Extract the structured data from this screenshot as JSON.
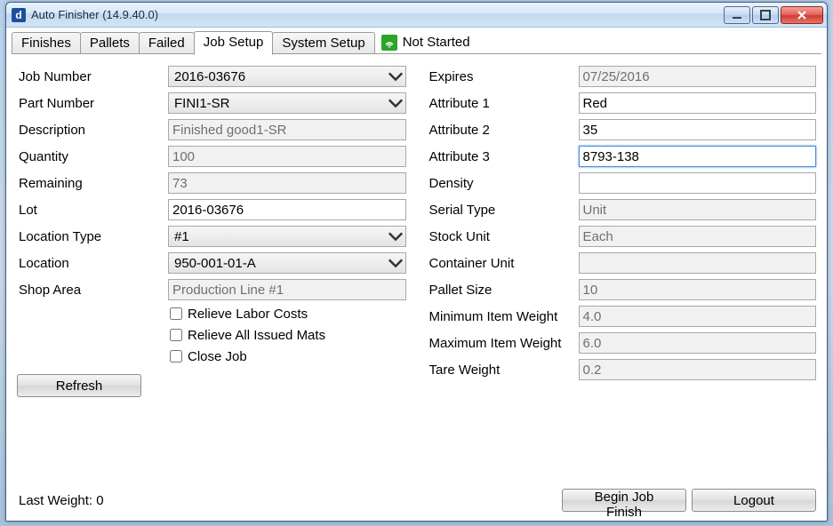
{
  "window": {
    "title": "Auto Finisher (14.9.40.0)",
    "app_icon_letter": "d"
  },
  "tabs": {
    "items": [
      {
        "label": "Finishes",
        "active": false
      },
      {
        "label": "Pallets",
        "active": false
      },
      {
        "label": "Failed",
        "active": false
      },
      {
        "label": "Job Setup",
        "active": true
      },
      {
        "label": "System Setup",
        "active": false
      }
    ],
    "status_text": "Not Started"
  },
  "left": {
    "job_number": {
      "label": "Job Number",
      "value": "2016-03676"
    },
    "part_number": {
      "label": "Part Number",
      "value": "FINI1-SR"
    },
    "description": {
      "label": "Description",
      "value": "Finished good1-SR"
    },
    "quantity": {
      "label": "Quantity",
      "value": "100"
    },
    "remaining": {
      "label": "Remaining",
      "value": "73"
    },
    "lot": {
      "label": "Lot",
      "value": "2016-03676"
    },
    "location_type": {
      "label": "Location Type",
      "value": "#1"
    },
    "location": {
      "label": "Location",
      "value": "950-001-01-A"
    },
    "shop_area": {
      "label": "Shop Area",
      "value": "Production Line #1"
    },
    "chk_relieve_labor": "Relieve Labor Costs",
    "chk_relieve_mats": "Relieve All Issued Mats",
    "chk_close_job": "Close Job",
    "refresh": "Refresh"
  },
  "right": {
    "expires": {
      "label": "Expires",
      "value": "07/25/2016"
    },
    "attr1": {
      "label": "Attribute 1",
      "value": "Red"
    },
    "attr2": {
      "label": "Attribute 2",
      "value": "35"
    },
    "attr3": {
      "label": "Attribute 3",
      "value": "8793-138"
    },
    "density": {
      "label": "Density",
      "value": ""
    },
    "serial_type": {
      "label": "Serial Type",
      "value": "Unit"
    },
    "stock_unit": {
      "label": "Stock Unit",
      "value": "Each"
    },
    "container_unit": {
      "label": "Container Unit",
      "value": ""
    },
    "pallet_size": {
      "label": "Pallet Size",
      "value": "10"
    },
    "min_weight": {
      "label": "Minimum Item Weight",
      "value": "4.0"
    },
    "max_weight": {
      "label": "Maximum Item Weight",
      "value": "6.0"
    },
    "tare_weight": {
      "label": "Tare Weight",
      "value": "0.2"
    }
  },
  "bottom": {
    "last_weight": "Last Weight: 0",
    "begin": "Begin Job Finish",
    "logout": "Logout"
  }
}
